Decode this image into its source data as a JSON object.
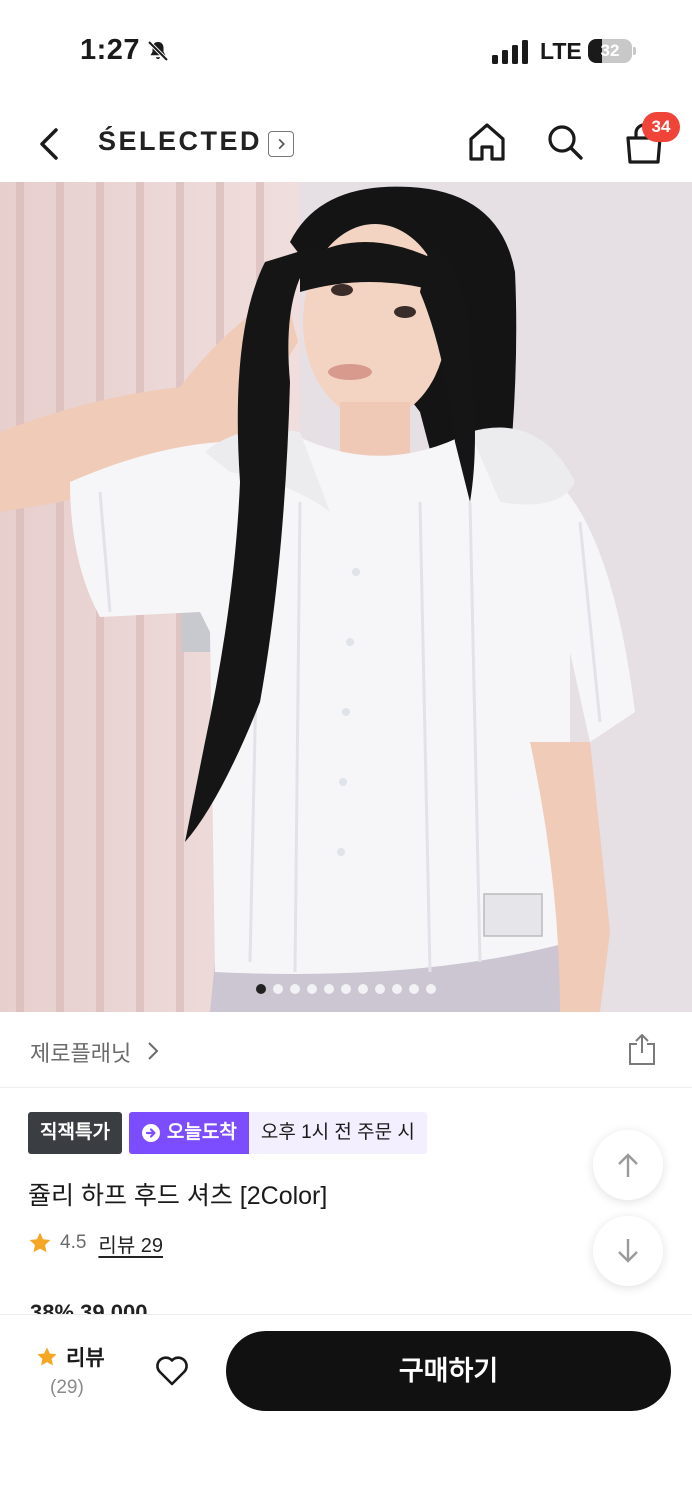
{
  "status_bar": {
    "time": "1:27",
    "network": "LTE",
    "battery": "32",
    "battery_level": 0.32
  },
  "nav": {
    "brand": "ŚELECTED",
    "cart_count": "34"
  },
  "gallery": {
    "total_images": 11,
    "current_index": 1
  },
  "store": {
    "name": "제로플래닛"
  },
  "badges": {
    "direct": "직잭특가",
    "today": "오늘도착",
    "cutoff": "오후 1시 전 주문 시"
  },
  "product": {
    "title": "쥴리 하프 후드 셔츠 [2Color]",
    "rating": "4.5",
    "review_label": "리뷰 29",
    "price_peek": "38% 39,000"
  },
  "bottom_bar": {
    "review_label": "리뷰",
    "review_count": "(29)",
    "buy_label": "구매하기"
  },
  "colors": {
    "accent_purple": "#7b4dff",
    "badge_dark": "#3a3d42",
    "cart_badge": "#f04438",
    "star": "#f5a623",
    "buy_button": "#111111"
  }
}
